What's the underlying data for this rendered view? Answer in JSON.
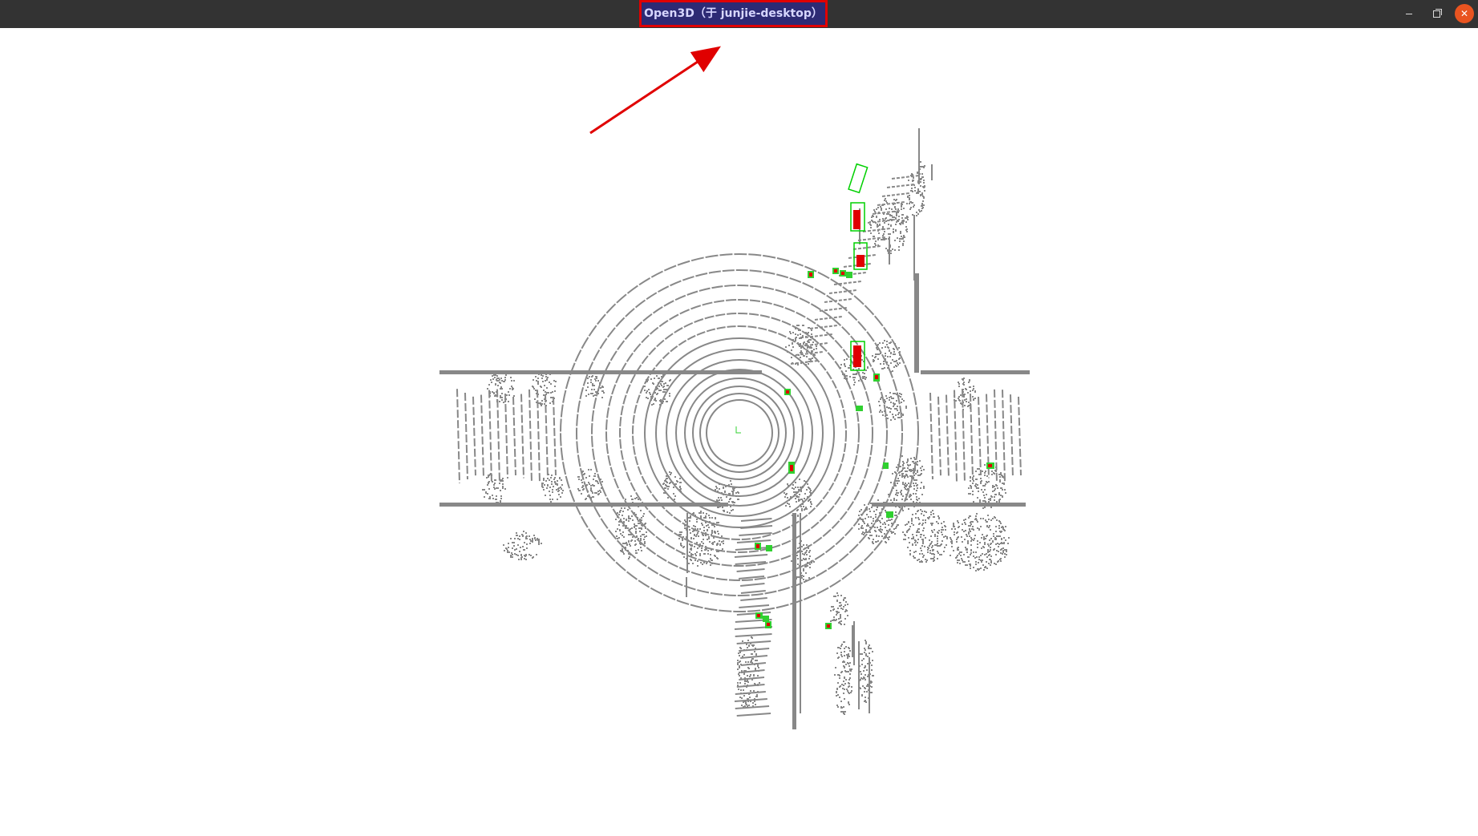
{
  "window": {
    "title": "Open3D（于 junjie-desktop）",
    "title_icon": "none",
    "controls": {
      "minimize_icon": "minimize-icon",
      "restore_icon": "restore-icon",
      "close_icon": "close-icon"
    }
  },
  "scene": {
    "background_color": "#ffffff",
    "point_color": "#888888",
    "object_point_color": "#e00000",
    "box_color": "#00d000",
    "annotation_color": "#e00000",
    "annotation_icon": "arrow-icon"
  }
}
